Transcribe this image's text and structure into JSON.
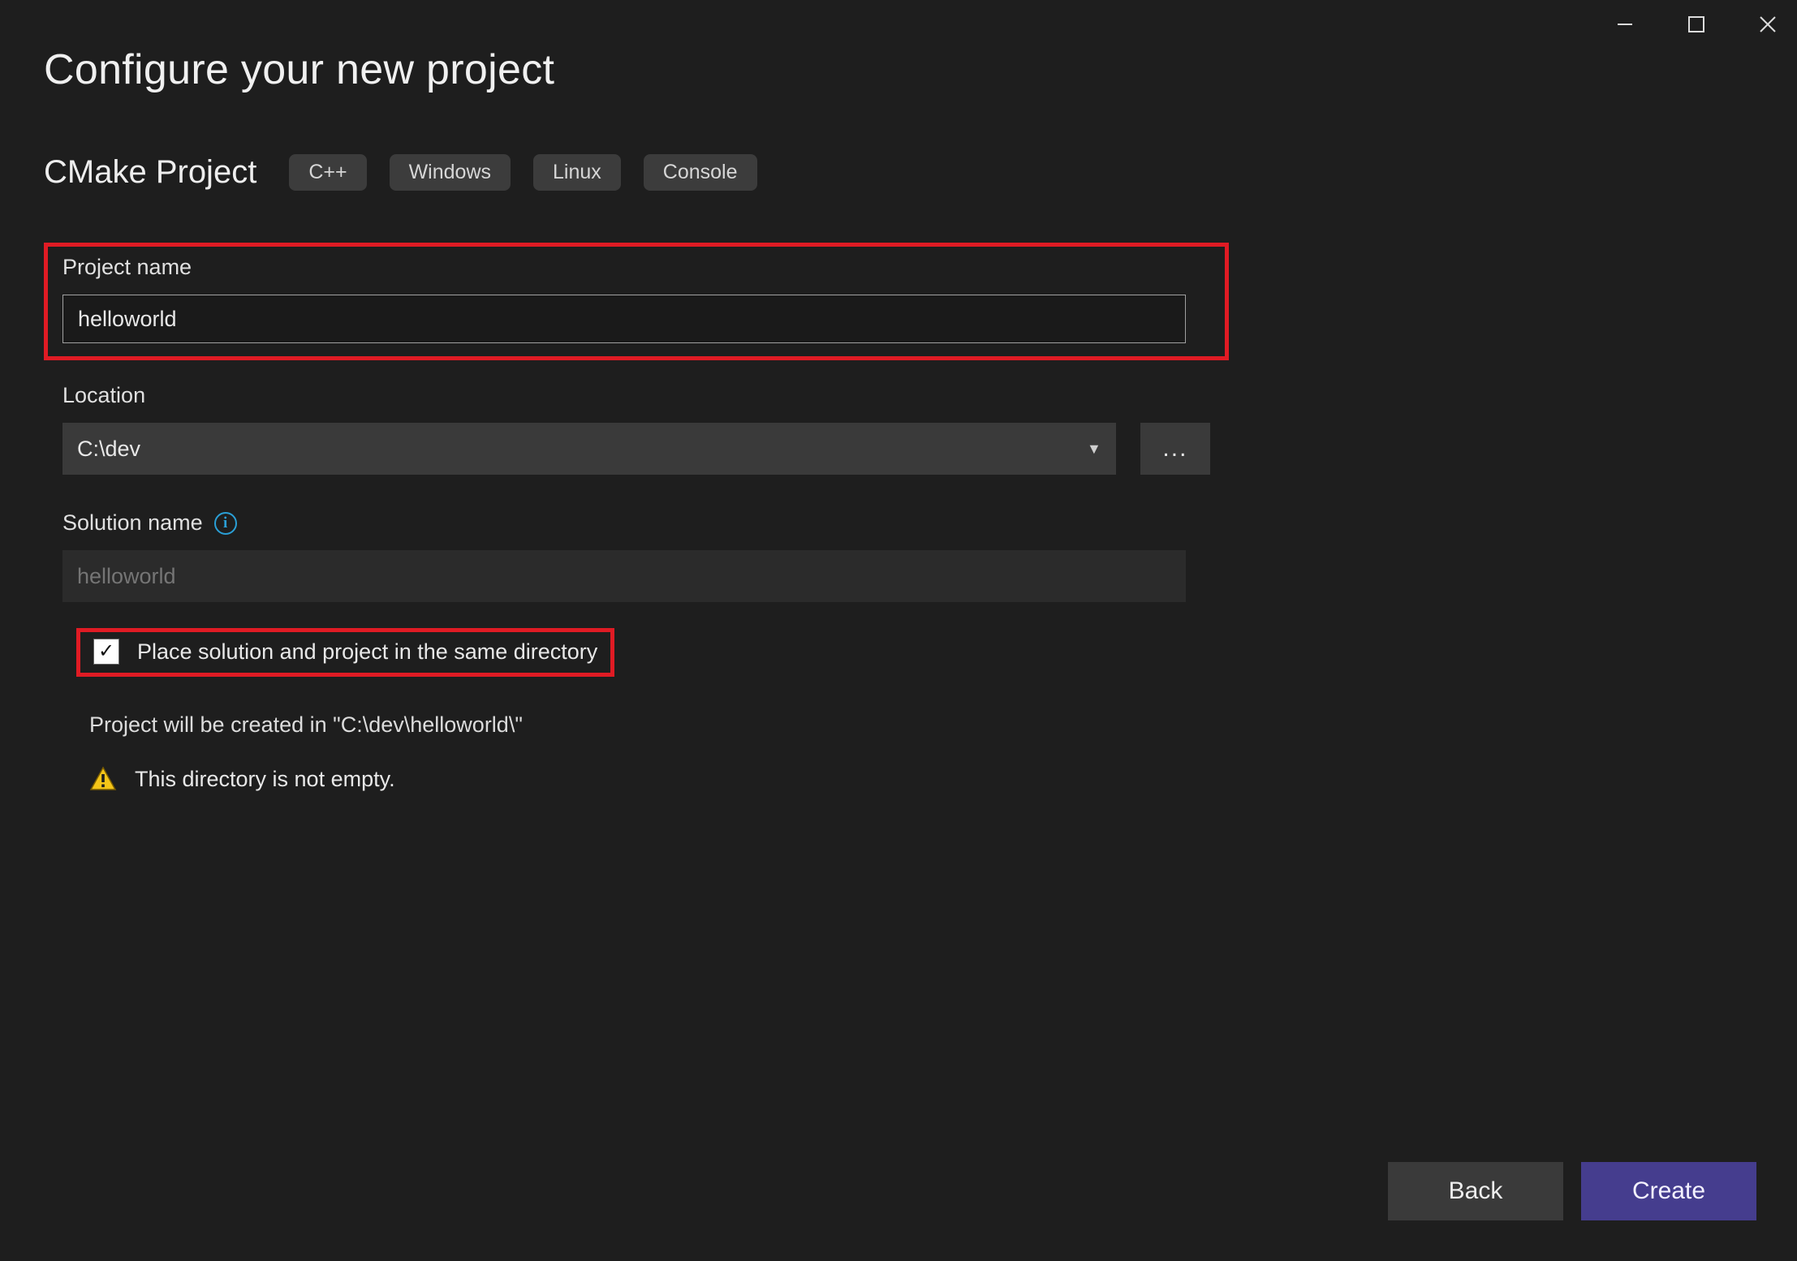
{
  "window": {
    "minimize_icon": "minimize",
    "maximize_icon": "maximize",
    "close_icon": "close"
  },
  "page_title": "Configure your new project",
  "template": {
    "name": "CMake Project",
    "tags": [
      "C++",
      "Windows",
      "Linux",
      "Console"
    ]
  },
  "project_name": {
    "label": "Project name",
    "value": "helloworld"
  },
  "location": {
    "label": "Location",
    "value": "C:\\dev",
    "browse_label": "..."
  },
  "solution_name": {
    "label": "Solution name",
    "placeholder": "helloworld",
    "info_tooltip": "i"
  },
  "same_dir": {
    "label": "Place solution and project in the same directory",
    "checked": true
  },
  "hint": "Project will be created in \"C:\\dev\\helloworld\\\"",
  "warning": "This directory is not empty.",
  "footer": {
    "back": "Back",
    "create": "Create"
  }
}
